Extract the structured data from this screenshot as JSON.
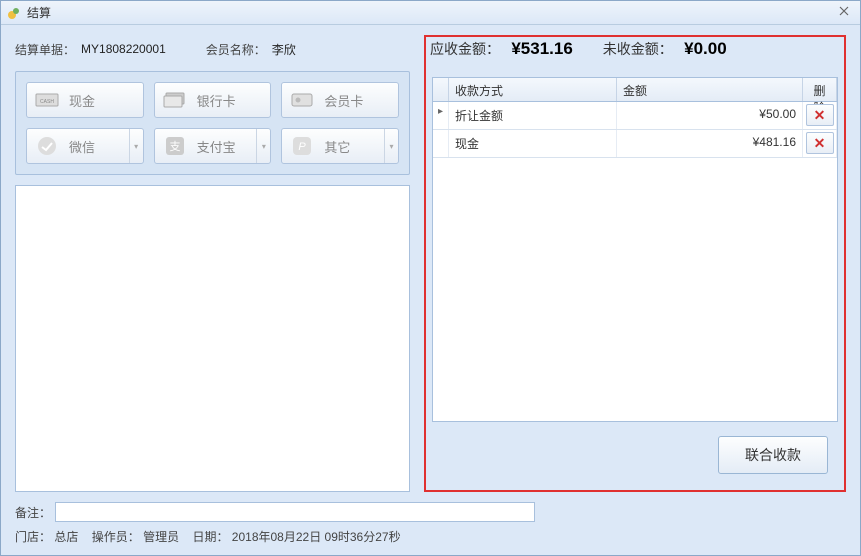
{
  "window": {
    "title": "结算"
  },
  "header": {
    "order_label": "结算单据：",
    "order_no": "MY1808220001",
    "member_label": "会员名称：",
    "member_name": "李欣"
  },
  "amounts": {
    "due_label": "应收金额：",
    "due_value": "¥531.16",
    "unpaid_label": "未收金额：",
    "unpaid_value": "¥0.00"
  },
  "pay_methods": {
    "cash": "现金",
    "bank": "银行卡",
    "member": "会员卡",
    "wechat": "微信",
    "alipay": "支付宝",
    "other": "其它"
  },
  "grid": {
    "col_method": "收款方式",
    "col_amount": "金额",
    "col_delete": "删除",
    "rows": [
      {
        "method": "折让金额",
        "amount": "¥50.00"
      },
      {
        "method": "现金",
        "amount": "¥481.16"
      }
    ]
  },
  "combine_button": "联合收款",
  "remark": {
    "label": "备注：",
    "value": ""
  },
  "statusbar": {
    "store_label": "门店：",
    "store": "总店",
    "operator_label": "操作员：",
    "operator": "管理员",
    "date_label": "日期：",
    "date": "2018年08月22日 09时36分27秒"
  }
}
